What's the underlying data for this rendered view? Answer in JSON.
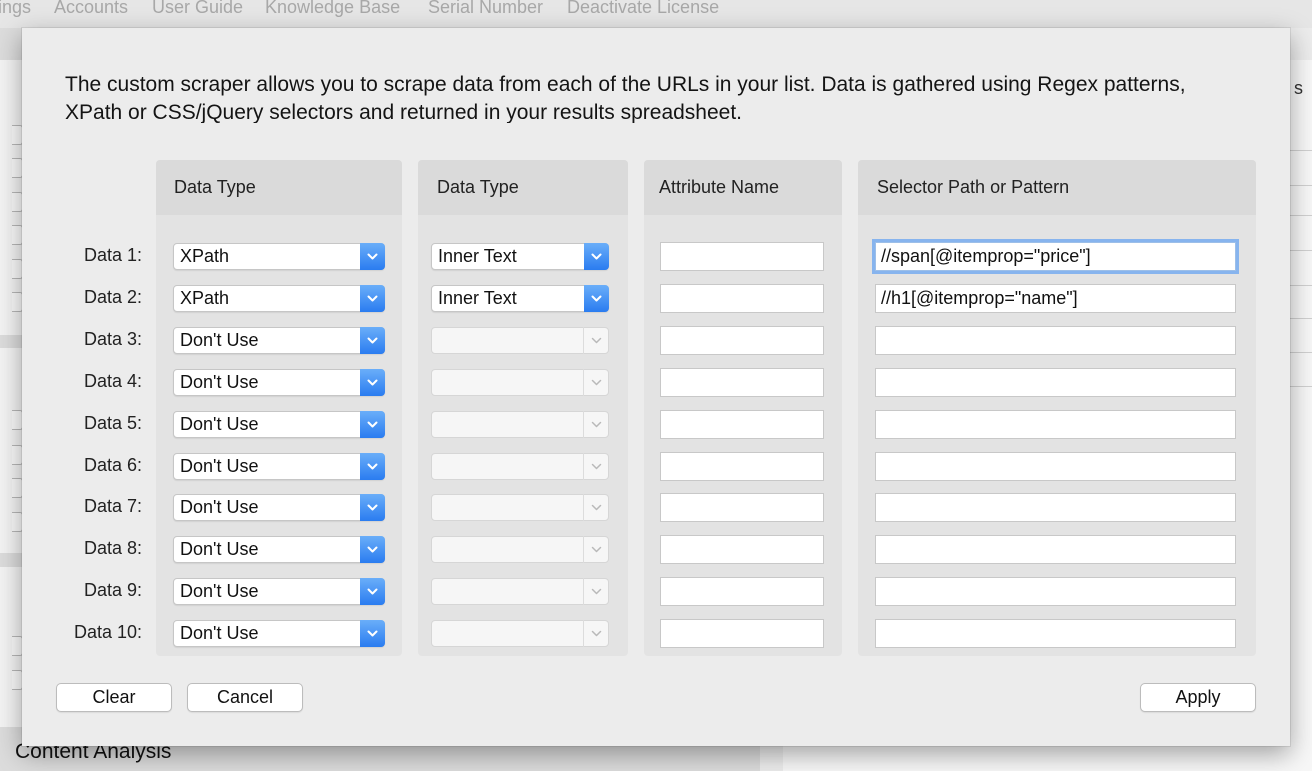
{
  "menubar": {
    "items": [
      "ings",
      "Accounts",
      "User Guide",
      "Knowledge Base",
      "Serial Number",
      "Deactivate License"
    ]
  },
  "background": {
    "bottom_label": "Content Analysis",
    "partial_right_text": "s"
  },
  "dialog": {
    "intro": "The custom scraper allows you to scrape data from each of the URLs in your list. Data is gathered using Regex patterns, XPath or CSS/jQuery selectors and returned in your results spreadsheet.",
    "columns": {
      "data_type": "Data Type",
      "data_type2": "Data Type",
      "attribute": "Attribute Name",
      "selector": "Selector Path or Pattern"
    },
    "rows": [
      {
        "label": "Data 1:",
        "type": "XPath",
        "extract": "Inner Text",
        "attribute": "",
        "selector": "//span[@itemprop=\"price\"]"
      },
      {
        "label": "Data 2:",
        "type": "XPath",
        "extract": "Inner Text",
        "attribute": "",
        "selector": "//h1[@itemprop=\"name\"]"
      },
      {
        "label": "Data 3:",
        "type": "Don't Use",
        "extract": "",
        "attribute": "",
        "selector": ""
      },
      {
        "label": "Data 4:",
        "type": "Don't Use",
        "extract": "",
        "attribute": "",
        "selector": ""
      },
      {
        "label": "Data 5:",
        "type": "Don't Use",
        "extract": "",
        "attribute": "",
        "selector": ""
      },
      {
        "label": "Data 6:",
        "type": "Don't Use",
        "extract": "",
        "attribute": "",
        "selector": ""
      },
      {
        "label": "Data 7:",
        "type": "Don't Use",
        "extract": "",
        "attribute": "",
        "selector": ""
      },
      {
        "label": "Data 8:",
        "type": "Don't Use",
        "extract": "",
        "attribute": "",
        "selector": ""
      },
      {
        "label": "Data 9:",
        "type": "Don't Use",
        "extract": "",
        "attribute": "",
        "selector": ""
      },
      {
        "label": "Data 10:",
        "type": "Don't Use",
        "extract": "",
        "attribute": "",
        "selector": ""
      }
    ],
    "buttons": {
      "clear": "Clear",
      "cancel": "Cancel",
      "apply": "Apply"
    }
  },
  "colors": {
    "dialog_bg": "#ececec",
    "popup_arrow": "#2a7cf0",
    "focus_ring": "#87b4ee"
  }
}
